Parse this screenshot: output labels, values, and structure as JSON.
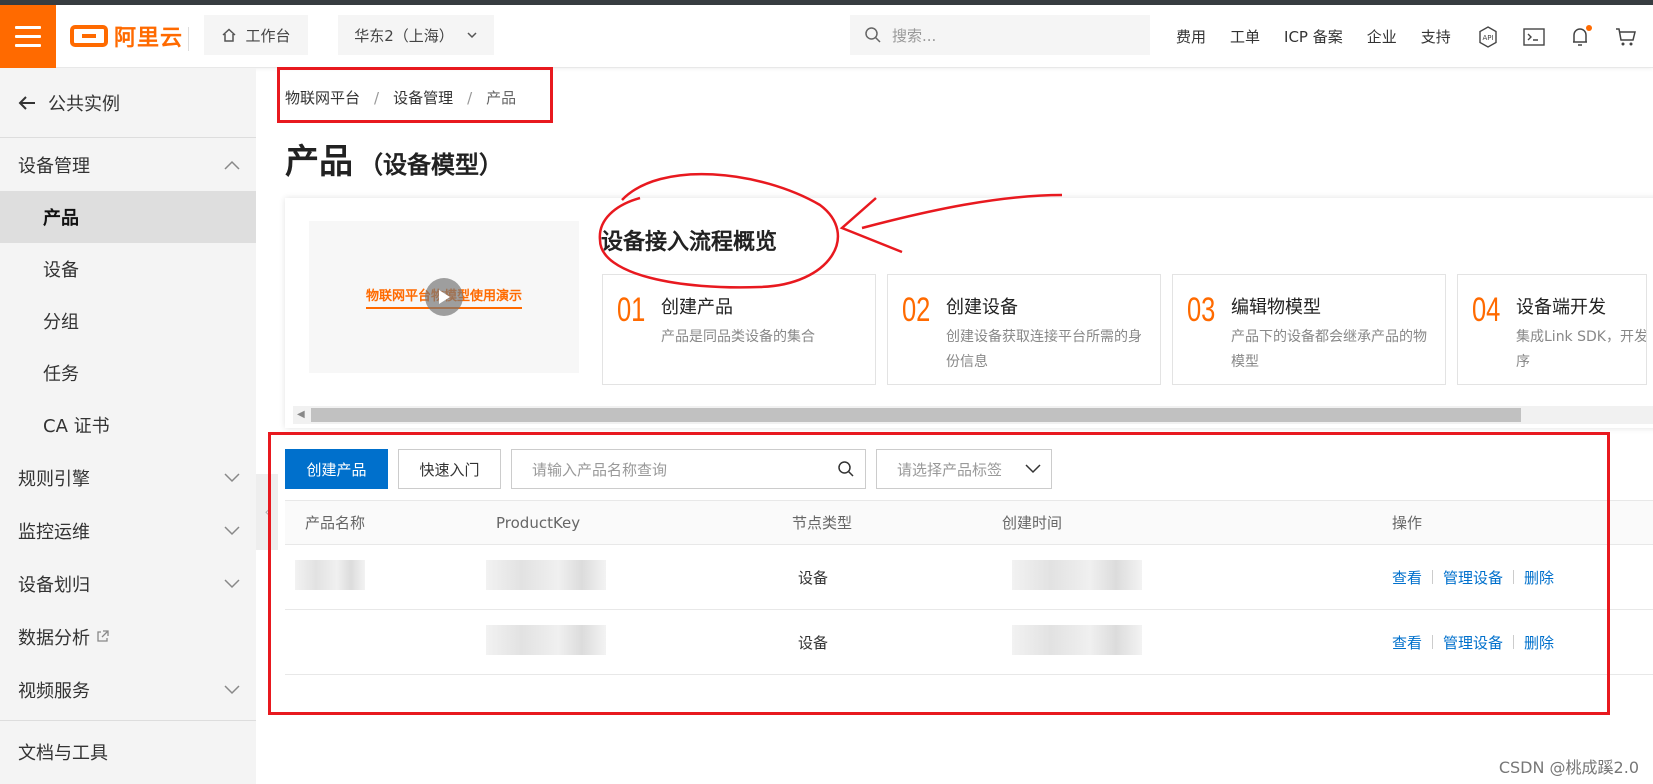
{
  "topbar": {
    "logo_text": "阿里云",
    "workbench": "工作台",
    "region": "华东2（上海）",
    "search_placeholder": "搜索...",
    "nav": [
      "费用",
      "工单",
      "ICP 备案",
      "企业",
      "支持"
    ],
    "icons": [
      "api-icon",
      "terminal-icon",
      "bell-icon",
      "cart-icon"
    ],
    "accent": "#ff6a00"
  },
  "sidebar": {
    "back_label": "公共实例",
    "groups": [
      {
        "label": "设备管理",
        "expanded": true,
        "items": [
          "产品",
          "设备",
          "分组",
          "任务",
          "CA 证书"
        ],
        "active": "产品"
      },
      {
        "label": "规则引擎"
      },
      {
        "label": "监控运维"
      },
      {
        "label": "设备划归"
      },
      {
        "label": "数据分析"
      },
      {
        "label": "视频服务"
      },
      {
        "label": "文档与工具"
      }
    ]
  },
  "breadcrumb": [
    "物联网平台",
    "设备管理",
    "产品"
  ],
  "page": {
    "title": "产品",
    "subtitle": "（设备模型）"
  },
  "overview": {
    "video_text": "物联网平台物模型使用演示",
    "title": "设备接入流程概览",
    "steps": [
      {
        "num": "01",
        "title": "创建产品",
        "desc": "产品是同品类设备的集合"
      },
      {
        "num": "02",
        "title": "创建设备",
        "desc": "创建设备获取连接平台所需的身份信息"
      },
      {
        "num": "03",
        "title": "编辑物模型",
        "desc": "产品下的设备都会继承产品的物模型"
      },
      {
        "num": "04",
        "title": "设备端开发",
        "desc": "集成Link SDK，开发序"
      }
    ]
  },
  "toolbar": {
    "create_button": "创建产品",
    "quick_start_button": "快速入门",
    "search_placeholder": "请输入产品名称查询",
    "tag_select_placeholder": "请选择产品标签"
  },
  "table": {
    "columns": [
      "产品名称",
      "ProductKey",
      "节点类型",
      "创建时间",
      "操作"
    ],
    "rows": [
      {
        "node_type": "设备",
        "actions": [
          "查看",
          "管理设备",
          "删除"
        ]
      },
      {
        "node_type": "设备",
        "actions": [
          "查看",
          "管理设备",
          "删除"
        ]
      }
    ]
  },
  "watermark": "CSDN @桃成蹊2.0",
  "colors": {
    "primary": "#0070cc",
    "annotation": "#e8191f",
    "brand": "#ff6a00"
  }
}
